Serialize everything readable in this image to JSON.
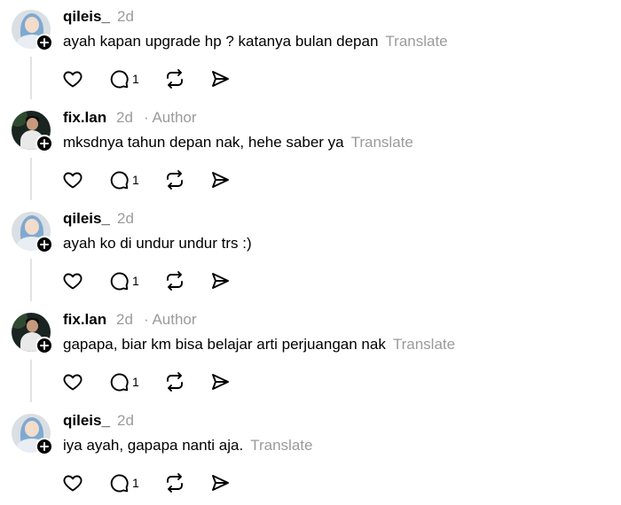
{
  "icons": {
    "follow": "plus-icon",
    "like": "heart-icon",
    "reply": "comment-icon",
    "repost": "repost-icon",
    "share": "send-icon"
  },
  "posts": [
    {
      "username": "qileis_",
      "time": "2d",
      "author_label": "",
      "text": "ayah kapan upgrade hp ? katanya bulan depan",
      "translate": "Translate",
      "reply_count": "1"
    },
    {
      "username": "fix.lan",
      "time": "2d",
      "author_label": "· Author",
      "text": "mksdnya tahun depan nak, hehe saber ya",
      "translate": "Translate",
      "reply_count": "1"
    },
    {
      "username": "qileis_",
      "time": "2d",
      "author_label": "",
      "text": "ayah ko di undur undur trs :)",
      "translate": "",
      "reply_count": "1"
    },
    {
      "username": "fix.lan",
      "time": "2d",
      "author_label": "· Author",
      "text": "gapapa, biar km bisa belajar arti perjuangan nak",
      "translate": "Translate",
      "reply_count": "1"
    },
    {
      "username": "qileis_",
      "time": "2d",
      "author_label": "",
      "text": "iya ayah, gapapa nanti aja.",
      "translate": "Translate",
      "reply_count": "1"
    }
  ]
}
